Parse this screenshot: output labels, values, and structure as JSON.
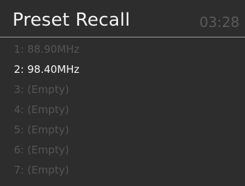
{
  "header": {
    "title": "Preset Recall",
    "time": "03:28"
  },
  "presets": [
    {
      "label": "1: 88.90MHz",
      "selected": false
    },
    {
      "label": "2: 98.40MHz",
      "selected": true
    },
    {
      "label": "3: (Empty)",
      "selected": false
    },
    {
      "label": "4: (Empty)",
      "selected": false
    },
    {
      "label": "5: (Empty)",
      "selected": false
    },
    {
      "label": "6: (Empty)",
      "selected": false
    },
    {
      "label": "7: (Empty)",
      "selected": false
    }
  ],
  "colors": {
    "background": "#2d2d2d",
    "title": "#f3f3f3",
    "selected_text": "#f5f5f5",
    "dimmed_text": "#555555",
    "divider": "#9a9a9a"
  }
}
